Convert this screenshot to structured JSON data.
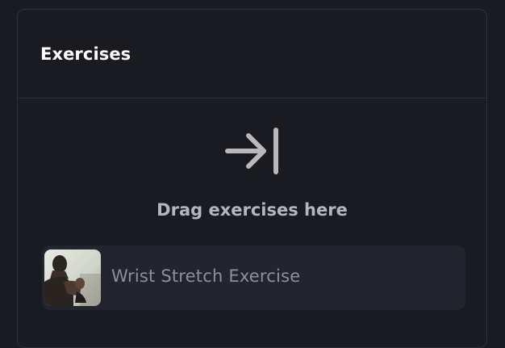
{
  "panel": {
    "title": "Exercises"
  },
  "drop_zone": {
    "icon": "arrow-to-bar-icon",
    "text": "Drag exercises here"
  },
  "exercises": [
    {
      "name": "Wrist Stretch Exercise",
      "thumbnail": "exercise-thumbnail-photo"
    }
  ],
  "colors": {
    "background": "#1a1b21",
    "border": "#2e313a",
    "item_background": "#22252e",
    "title": "#ffffff",
    "drop_text": "#b4b6bc",
    "icon": "#b9b9bd",
    "item_text": "#8c909a"
  }
}
